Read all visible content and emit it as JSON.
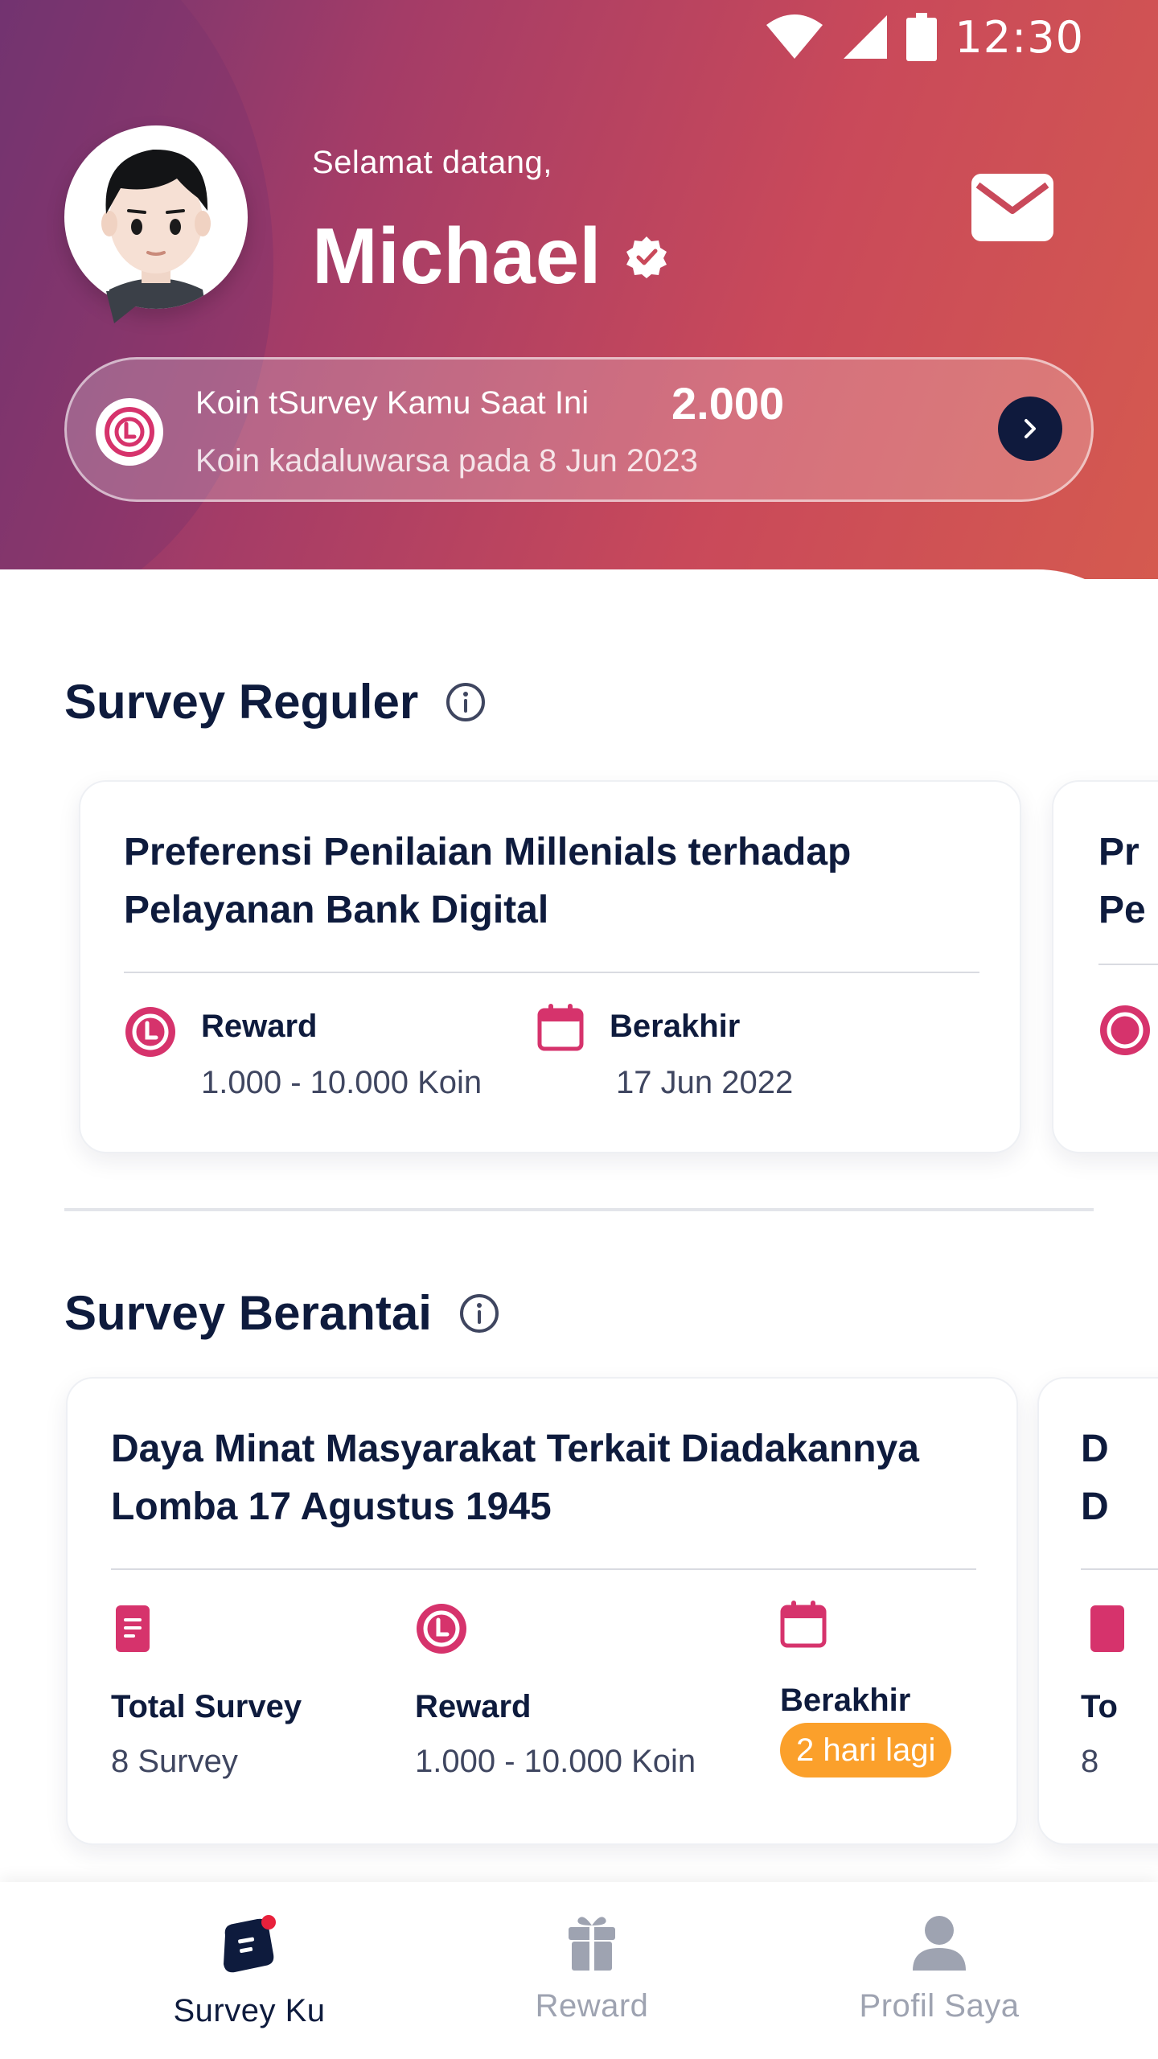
{
  "status_bar": {
    "time": "12:30"
  },
  "greeting": {
    "welcome": "Selamat datang,",
    "name": "Michael"
  },
  "coin": {
    "label": "Koin tSurvey Kamu Saat Ini",
    "amount": "2.000",
    "expiry": "Koin kadaluwarsa pada 8 Jun 2023"
  },
  "regular": {
    "title": "Survey Reguler",
    "cards": [
      {
        "title": "Preferensi Penilaian Millenials terhadap Pelayanan Bank Digital",
        "reward_label": "Reward",
        "reward_value": "1.000 - 10.000 Koin",
        "end_label": "Berakhir",
        "end_value": "17 Jun 2022"
      },
      {
        "title_partial": "Pr",
        "title_partial_2": "Pe"
      }
    ]
  },
  "chain": {
    "title": "Survey Berantai",
    "cards": [
      {
        "title": "Daya Minat Masyarakat Terkait Diadakannya Lomba 17 Agustus 1945",
        "total_label": "Total Survey",
        "total_value": "8 Survey",
        "reward_label": "Reward",
        "reward_value": "1.000 - 10.000 Koin",
        "end_label": "Berakhir",
        "end_badge": "2 hari lagi"
      },
      {
        "title_partial": "D",
        "title_partial_2": "D",
        "total_partial": "To",
        "total_value_partial": "8"
      }
    ]
  },
  "nav": {
    "items": [
      {
        "label": "Survey Ku",
        "icon": "survey-icon",
        "active": true
      },
      {
        "label": "Reward",
        "icon": "gift-icon",
        "active": false
      },
      {
        "label": "Profil Saya",
        "icon": "user-icon",
        "active": false
      }
    ]
  },
  "colors": {
    "brand_red": "#c9495a",
    "navy": "#0e1b3d",
    "badge_orange": "#fba02b",
    "coin_pink": "#d6336c"
  }
}
